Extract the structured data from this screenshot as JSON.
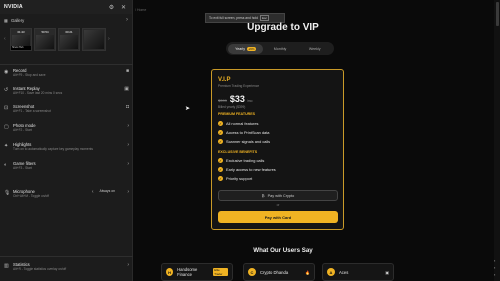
{
  "overlay": {
    "title": "NVIDIA",
    "gallery_label": "Gallery",
    "thumbs": [
      {
        "time": "01:43",
        "caption": ""
      },
      {
        "time": "50:54",
        "caption": ""
      },
      {
        "time": "00:21",
        "caption": ""
      },
      {
        "time": "",
        "caption": ""
      }
    ],
    "thumb_footer": "Sheki Hub",
    "items": [
      {
        "name": "Record",
        "sub": "Alt+F9 - Stop and save"
      },
      {
        "name": "Instant Replay",
        "sub": "Alt+F10 - Save last 20 mins 0 secs"
      },
      {
        "name": "Screenshot",
        "sub": "Alt+F1 - Take a screenshot"
      },
      {
        "name": "Photo mode",
        "sub": "Alt+F2 - Start"
      },
      {
        "name": "Highlights",
        "sub": "Turn on to automatically capture key gameplay moments"
      },
      {
        "name": "Game filters",
        "sub": "Alt+F3 - Start"
      },
      {
        "name": "Microphone",
        "sub": "Ctrl+Alt+M - Toggle on/off",
        "extra": "Always on"
      },
      {
        "name": "Statistics",
        "sub": "Alt+R - Toggle statistics overlay on/off"
      }
    ]
  },
  "site": {
    "breadcrumb": "/ Home",
    "fullscreen_toast": "To exit full screen, press and hold",
    "fullscreen_key": "Esc",
    "heading": "Upgrade to VIP",
    "tabs": {
      "yearly": "Yearly",
      "yearly_badge": "-20%",
      "monthly": "Monthly",
      "weekly": "Weekly"
    },
    "plan": {
      "name": "V.I.P",
      "subtitle": "Premium Trading Experience",
      "old_price": "$399",
      "price": "$33",
      "per": "/mo",
      "billed": "Billed yearly ($399)",
      "premium_title": "PREMIUM FEATURES",
      "premium": [
        "All normal features",
        "Access to PrintScan data",
        "Scanner signals and calls"
      ],
      "exclusive_title": "EXCLUSIVE BENEFITS",
      "exclusive": [
        "Exclusive trading calls",
        "Early access to new features",
        "Priority support"
      ],
      "crypto_btn": "Pay with Crypto",
      "or": "or",
      "card_btn": "Pay with Card"
    },
    "testimonials_title": "What Our Users Say",
    "reviews": [
      {
        "initial": "H",
        "name": "Handsome Finance",
        "tag": "Elite Trader"
      },
      {
        "initial": "C",
        "name": "Crypto Dhanda",
        "tag": ""
      },
      {
        "initial": "A",
        "name": "Aces",
        "tag": ""
      }
    ]
  }
}
